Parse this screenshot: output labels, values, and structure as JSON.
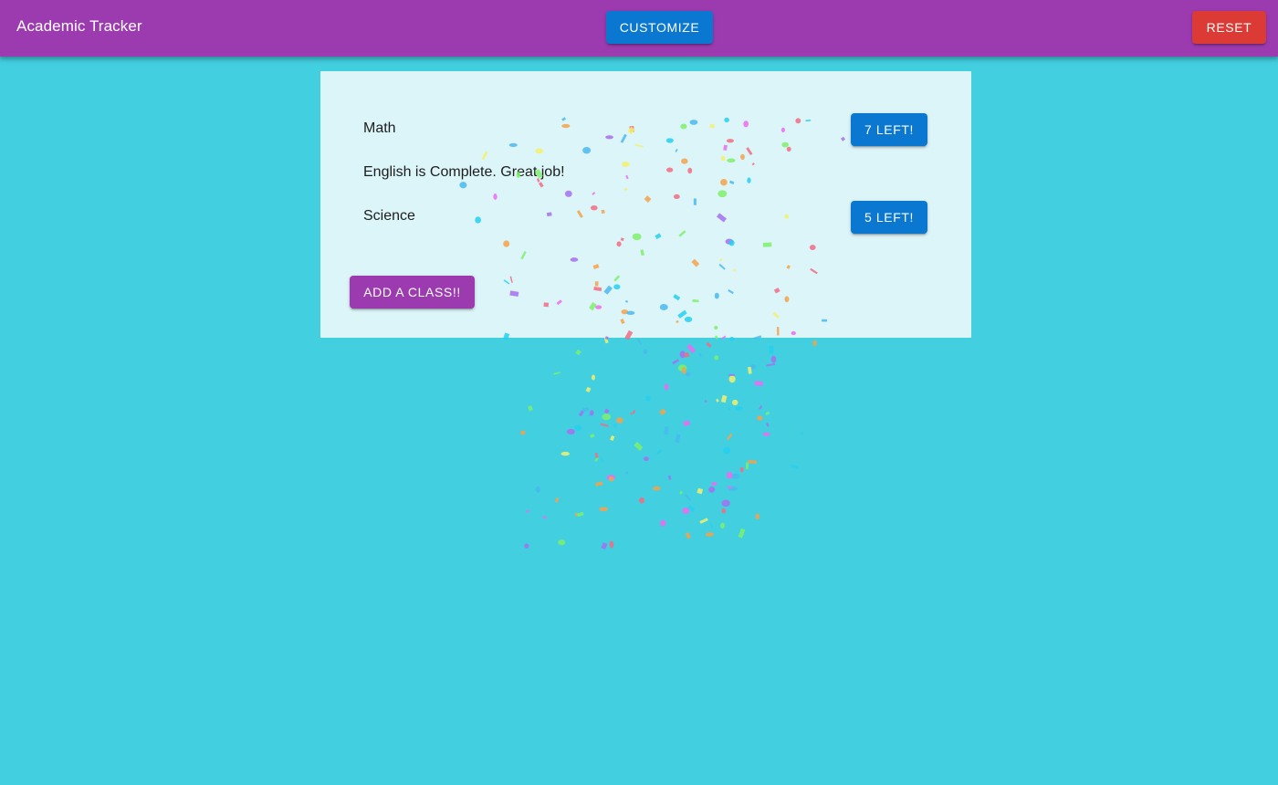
{
  "app": {
    "title": "Academic Tracker"
  },
  "header": {
    "customize_label": "CUSTOMIZE",
    "reset_label": "RESET"
  },
  "classes": [
    {
      "name": "Math",
      "status_label": "7 LEFT!"
    },
    {
      "name": "English is Complete. Great job!",
      "status_label": ""
    },
    {
      "name": "Science",
      "status_label": "5 LEFT!"
    }
  ],
  "actions": {
    "add_class_label": "ADD A CLASS!!"
  },
  "colors": {
    "appbar": "#9c3bb0",
    "background": "#42cfe0",
    "card": "#dcf5f9",
    "primary_button": "#0a78d0",
    "reset_button": "#dc3a35",
    "add_button": "#9c3bb0",
    "confetti": [
      "#a66ef0",
      "#f36b82",
      "#f5a14a",
      "#f5f06a",
      "#7ef06a",
      "#25d0f0",
      "#ef6af0",
      "#4ab8f0"
    ]
  },
  "effects": {
    "confetti": "celebration-confetti"
  }
}
